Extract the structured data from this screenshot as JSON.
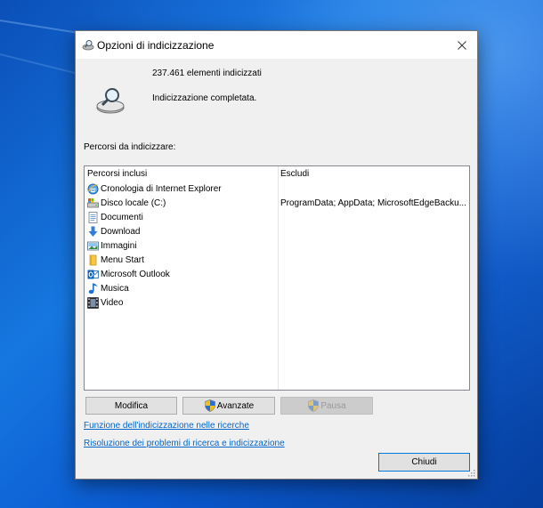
{
  "window": {
    "title": "Opzioni di indicizzazione",
    "close_label": "×"
  },
  "status": {
    "indexed_count": "237.461 elementi indicizzati",
    "state": "Indicizzazione completata."
  },
  "paths": {
    "section_label": "Percorsi da indicizzare:",
    "columns": {
      "included": "Percorsi inclusi",
      "excluded": "Escludi"
    },
    "items": [
      {
        "label": "Cronologia di Internet Explorer",
        "icon": "internet-explorer-icon",
        "exclude": ""
      },
      {
        "label": "Disco locale (C:)",
        "icon": "local-disk-icon",
        "exclude": "ProgramData; AppData; MicrosoftEdgeBacku..."
      },
      {
        "label": "Documenti",
        "icon": "documents-icon",
        "exclude": ""
      },
      {
        "label": "Download",
        "icon": "download-icon",
        "exclude": ""
      },
      {
        "label": "Immagini",
        "icon": "pictures-icon",
        "exclude": ""
      },
      {
        "label": "Menu Start",
        "icon": "start-menu-folder-icon",
        "exclude": ""
      },
      {
        "label": "Microsoft Outlook",
        "icon": "outlook-icon",
        "exclude": ""
      },
      {
        "label": "Musica",
        "icon": "music-icon",
        "exclude": ""
      },
      {
        "label": "Video",
        "icon": "video-icon",
        "exclude": ""
      }
    ]
  },
  "buttons": {
    "modify": "Modifica",
    "advanced": "Avanzate",
    "pause": "Pausa",
    "close": "Chiudi"
  },
  "links": {
    "how_indexing": "Funzione dell'indicizzazione nelle ricerche",
    "troubleshoot": "Risoluzione dei problemi di ricerca e indicizzazione"
  },
  "colors": {
    "accent": "#0078d7",
    "link": "#0066cc",
    "desktop": "#0a5ad0"
  }
}
